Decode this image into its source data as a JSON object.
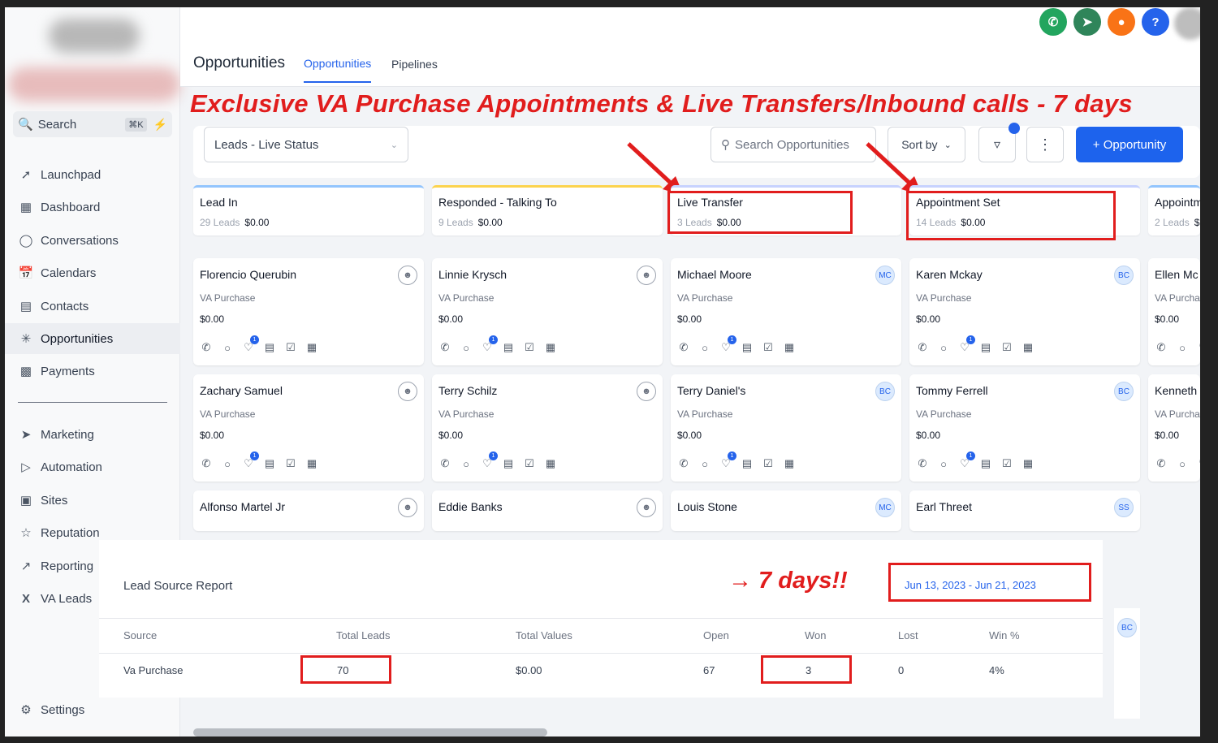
{
  "sidebar": {
    "search_label": "Search",
    "search_shortcut": "⌘K",
    "items": [
      {
        "label": "Launchpad",
        "icon": "rocket-icon"
      },
      {
        "label": "Dashboard",
        "icon": "grid-icon"
      },
      {
        "label": "Conversations",
        "icon": "chat-icon"
      },
      {
        "label": "Calendars",
        "icon": "calendar-icon"
      },
      {
        "label": "Contacts",
        "icon": "contacts-icon"
      },
      {
        "label": "Opportunities",
        "icon": "opportunities-icon",
        "active": true
      },
      {
        "label": "Payments",
        "icon": "payments-icon"
      },
      {
        "label": "Marketing",
        "icon": "send-icon"
      },
      {
        "label": "Automation",
        "icon": "automation-icon"
      },
      {
        "label": "Sites",
        "icon": "sites-icon"
      },
      {
        "label": "Reputation",
        "icon": "star-icon"
      },
      {
        "label": "Reporting",
        "icon": "trend-icon"
      },
      {
        "label": "VA Leads",
        "icon": "excel-icon"
      }
    ],
    "settings_label": "Settings"
  },
  "header": {
    "title": "Opportunities",
    "tabs": [
      "Opportunities",
      "Pipelines"
    ],
    "icons": [
      "phone-icon",
      "megaphone-icon",
      "bell-icon",
      "help-icon"
    ],
    "icon_colors": {
      "phone": "#22a55e",
      "megaphone": "#2f855a",
      "bell": "#f97316",
      "help": "#2563eb"
    }
  },
  "annotation": {
    "banner": "Exclusive VA Purchase Appointments & Live Transfers/Inbound calls - 7 days",
    "days_note": "→ 7 days!!",
    "color": "#e11d1d"
  },
  "toolbar": {
    "pipeline_select": "Leads - Live Status",
    "search_placeholder": "Search Opportunities",
    "sort_label": "Sort by",
    "add_label": "+ Opportunity"
  },
  "columns": [
    {
      "name": "Lead In",
      "count": "29 Leads",
      "value": "$0.00"
    },
    {
      "name": "Responded - Talking To",
      "count": "9 Leads",
      "value": "$0.00"
    },
    {
      "name": "Live Transfer",
      "count": "3 Leads",
      "value": "$0.00"
    },
    {
      "name": "Appointment Set",
      "count": "14 Leads",
      "value": "$0.00"
    },
    {
      "name": "Appointm",
      "count": "2 Leads",
      "value": "$"
    }
  ],
  "cards": [
    [
      {
        "name": "Florencio Querubin",
        "source": "VA Purchase",
        "value": "$0.00",
        "avatar": ""
      },
      {
        "name": "Zachary Samuel",
        "source": "VA Purchase",
        "value": "$0.00",
        "avatar": ""
      },
      {
        "name": "Alfonso Martel Jr",
        "avatar": ""
      }
    ],
    [
      {
        "name": "Linnie Krysch",
        "source": "VA Purchase",
        "value": "$0.00",
        "avatar": ""
      },
      {
        "name": "Terry Schilz",
        "source": "VA Purchase",
        "value": "$0.00",
        "avatar": ""
      },
      {
        "name": "Eddie Banks",
        "avatar": ""
      }
    ],
    [
      {
        "name": "Michael Moore",
        "source": "VA Purchase",
        "value": "$0.00",
        "avatar": "MC"
      },
      {
        "name": "Terry Daniel's",
        "source": "VA Purchase",
        "value": "$0.00",
        "avatar": "BC"
      },
      {
        "name": "Louis Stone",
        "avatar": "MC"
      }
    ],
    [
      {
        "name": "Karen Mckay",
        "source": "VA Purchase",
        "value": "$0.00",
        "avatar": "BC"
      },
      {
        "name": "Tommy Ferrell",
        "source": "VA Purchase",
        "value": "$0.00",
        "avatar": "BC"
      },
      {
        "name": "Earl Threet",
        "avatar": "SS"
      }
    ],
    [
      {
        "name": "Ellen Mc",
        "source": "VA Purcha",
        "value": "$0.00"
      },
      {
        "name": "Kenneth",
        "source": "VA Purcha",
        "value": "$0.00"
      }
    ]
  ],
  "extra_avatar": "BC",
  "report": {
    "title": "Lead Source Report",
    "date_range": "Jun 13, 2023 - Jun 21, 2023",
    "headers": [
      "Source",
      "Total Leads",
      "Total Values",
      "Open",
      "Won",
      "Lost",
      "Win %"
    ],
    "row": [
      "Va Purchase",
      "70",
      "$0.00",
      "67",
      "3",
      "0",
      "4%"
    ]
  }
}
